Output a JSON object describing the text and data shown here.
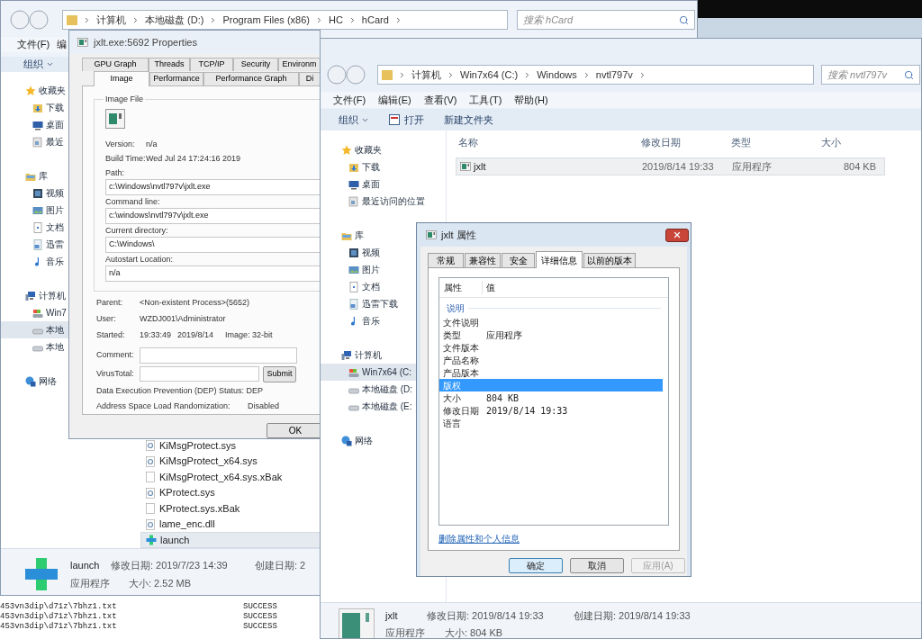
{
  "back_explorer": {
    "breadcrumb": [
      "计算机",
      "本地磁盘 (D:)",
      "Program Files (x86)",
      "HC",
      "hCard"
    ],
    "search_placeholder": "搜索 hCard",
    "menu": [
      "文件(F)",
      "编"
    ],
    "organize": "组织",
    "sidebar": [
      {
        "label": "收藏夹",
        "kind": "favorites",
        "selected": false,
        "children": [
          {
            "label": "下载",
            "kind": "downloads",
            "selected": false
          },
          {
            "label": "桌面",
            "kind": "desktop",
            "selected": false
          },
          {
            "label": "最近",
            "kind": "recent",
            "selected": false
          }
        ]
      },
      {
        "label": "库",
        "kind": "library",
        "selected": false,
        "children": [
          {
            "label": "视频",
            "kind": "video",
            "selected": false
          },
          {
            "label": "图片",
            "kind": "picture",
            "selected": false
          },
          {
            "label": "文档",
            "kind": "document",
            "selected": false
          },
          {
            "label": "迅雷",
            "kind": "page",
            "selected": false
          },
          {
            "label": "音乐",
            "kind": "music",
            "selected": false
          }
        ]
      },
      {
        "label": "计算机",
        "kind": "computer",
        "selected": false,
        "children": [
          {
            "label": "Win7",
            "kind": "system_drive",
            "selected": false
          },
          {
            "label": "本地",
            "kind": "drive",
            "selected": true
          },
          {
            "label": "本地",
            "kind": "drive",
            "selected": false
          }
        ]
      },
      {
        "label": "网络",
        "kind": "network",
        "selected": false
      }
    ],
    "files": [
      {
        "name": "KiMsgProtect.sys",
        "kind": "system",
        "selected": false
      },
      {
        "name": "KiMsgProtect_x64.sys",
        "kind": "system",
        "selected": false
      },
      {
        "name": "KiMsgProtect_x64.sys.xBak",
        "kind": "blank",
        "selected": false
      },
      {
        "name": "KProtect.sys",
        "kind": "system",
        "selected": false
      },
      {
        "name": "KProtect.sys.xBak",
        "kind": "blank",
        "selected": false
      },
      {
        "name": "lame_enc.dll",
        "kind": "system",
        "selected": false
      },
      {
        "name": "launch",
        "kind": "launcher",
        "selected": true
      }
    ],
    "details": {
      "name": "launch",
      "type": "应用程序",
      "modified": "修改日期: 2019/7/23 14:39",
      "size": "大小: 2.52 MB",
      "created": "创建日期: 2"
    }
  },
  "log": [
    {
      "path": "453vn3dip\\d71z\\7bhz1.txt",
      "status": "SUCCESS"
    },
    {
      "path": "453vn3dip\\d71z\\7bhz1.txt",
      "status": "SUCCESS"
    },
    {
      "path": "453vn3dip\\d71z\\7bhz1.txt",
      "status": "SUCCESS"
    }
  ],
  "process_properties": {
    "title": "jxlt.exe:5692 Properties",
    "tabs_top": [
      {
        "label": "GPU Graph",
        "selected": false
      },
      {
        "label": "Threads",
        "selected": false
      },
      {
        "label": "TCP/IP",
        "selected": false
      },
      {
        "label": "Security",
        "selected": false
      },
      {
        "label": "Environm",
        "selected": false
      }
    ],
    "tabs_bottom": [
      {
        "label": "Image",
        "selected": true
      },
      {
        "label": "Performance",
        "selected": false
      },
      {
        "label": "Performance Graph",
        "selected": false
      },
      {
        "label": "Di",
        "selected": false
      }
    ],
    "group_title": "Image File",
    "info": [
      {
        "label": "Version:",
        "value": "n/a"
      },
      {
        "label": "Build Time:",
        "value": "Wed Jul 24 17:24:16 2019"
      }
    ],
    "fields": [
      {
        "label": "Path:",
        "value": "c:\\Windows\\nvtl797v\\jxlt.exe"
      },
      {
        "label": "Command line:",
        "value": "c:\\windows\\nvtl797v\\jxlt.exe"
      },
      {
        "label": "Current directory:",
        "value": "C:\\Windows\\"
      },
      {
        "label": "Autostart Location:",
        "value": "n/a"
      }
    ],
    "parent_label": "Parent:",
    "parent": "<Non-existent Process>(5652)",
    "user_label": "User:",
    "user": "WZDJ001\\Administrator",
    "started_label": "Started:",
    "started_time": "19:33:49",
    "started_date": "2019/8/14",
    "image_bits": "Image: 32-bit",
    "comment_label": "Comment:",
    "virustotal_label": "VirusTotal:",
    "submit": "Submit",
    "dep": "Data Execution Prevention (DEP) Status: DEP",
    "aslr_label": "Address Space Load Randomization:",
    "aslr": "Disabled",
    "ok": "OK"
  },
  "explorer": {
    "breadcrumb": [
      "计算机",
      "Win7x64 (C:)",
      "Windows",
      "nvtl797v"
    ],
    "search_placeholder": "搜索 nvtl797v",
    "menu": [
      "文件(F)",
      "编辑(E)",
      "查看(V)",
      "工具(T)",
      "帮助(H)"
    ],
    "organize": "组织",
    "open": "打开",
    "new_folder": "新建文件夹",
    "columns": [
      "名称",
      "修改日期",
      "类型",
      "大小"
    ],
    "sidebar": [
      {
        "label": "收藏夹",
        "kind": "favorites",
        "selected": false,
        "children": [
          {
            "label": "下载",
            "kind": "downloads",
            "selected": false
          },
          {
            "label": "桌面",
            "kind": "desktop",
            "selected": false
          },
          {
            "label": "最近访问的位置",
            "kind": "recent",
            "selected": false
          }
        ]
      },
      {
        "label": "库",
        "kind": "library",
        "selected": false,
        "children": [
          {
            "label": "视频",
            "kind": "video",
            "selected": false
          },
          {
            "label": "图片",
            "kind": "picture",
            "selected": false
          },
          {
            "label": "文档",
            "kind": "document",
            "selected": false
          },
          {
            "label": "迅雷下载",
            "kind": "page",
            "selected": false
          },
          {
            "label": "音乐",
            "kind": "music",
            "selected": false
          }
        ]
      },
      {
        "label": "计算机",
        "kind": "computer",
        "selected": false,
        "children": [
          {
            "label": "Win7x64 (C:",
            "kind": "system_drive",
            "selected": true
          },
          {
            "label": "本地磁盘 (D:",
            "kind": "drive",
            "selected": false
          },
          {
            "label": "本地磁盘 (E:",
            "kind": "drive",
            "selected": false
          }
        ]
      },
      {
        "label": "网络",
        "kind": "network",
        "selected": false
      }
    ],
    "files": [
      {
        "name": "jxlt",
        "modified": "2019/8/14 19:33",
        "type": "应用程序",
        "size": "804 KB",
        "selected": true
      }
    ],
    "details": {
      "name": "jxlt",
      "type": "应用程序",
      "modified": "修改日期: 2019/8/14 19:33",
      "size": "大小: 804 KB",
      "created": "创建日期: 2019/8/14 19:33"
    }
  },
  "file_properties": {
    "title": "jxlt 属性",
    "tabs": [
      {
        "label": "常规",
        "selected": false
      },
      {
        "label": "兼容性",
        "selected": false
      },
      {
        "label": "安全",
        "selected": false
      },
      {
        "label": "详细信息",
        "selected": true
      },
      {
        "label": "以前的版本",
        "selected": false
      }
    ],
    "columns": [
      "属性",
      "值"
    ],
    "group": "说明",
    "rows": [
      {
        "name": "文件说明",
        "selected": false
      },
      {
        "name": "类型",
        "value": "应用程序",
        "selected": false
      },
      {
        "name": "文件版本",
        "selected": false
      },
      {
        "name": "产品名称",
        "selected": false
      },
      {
        "name": "产品版本",
        "selected": false
      },
      {
        "name": "版权",
        "selected": true
      },
      {
        "name": "大小",
        "value": "804 KB",
        "selected": false
      },
      {
        "name": "修改日期",
        "value": "2019/8/14 19:33",
        "selected": false
      },
      {
        "name": "语言",
        "selected": false
      }
    ],
    "remove_link": "删除属性和个人信息",
    "buttons": [
      {
        "label": "确定",
        "default": true,
        "disabled": false
      },
      {
        "label": "取消",
        "default": false,
        "disabled": false
      },
      {
        "label": "应用(A)",
        "default": false,
        "disabled": true
      }
    ]
  }
}
